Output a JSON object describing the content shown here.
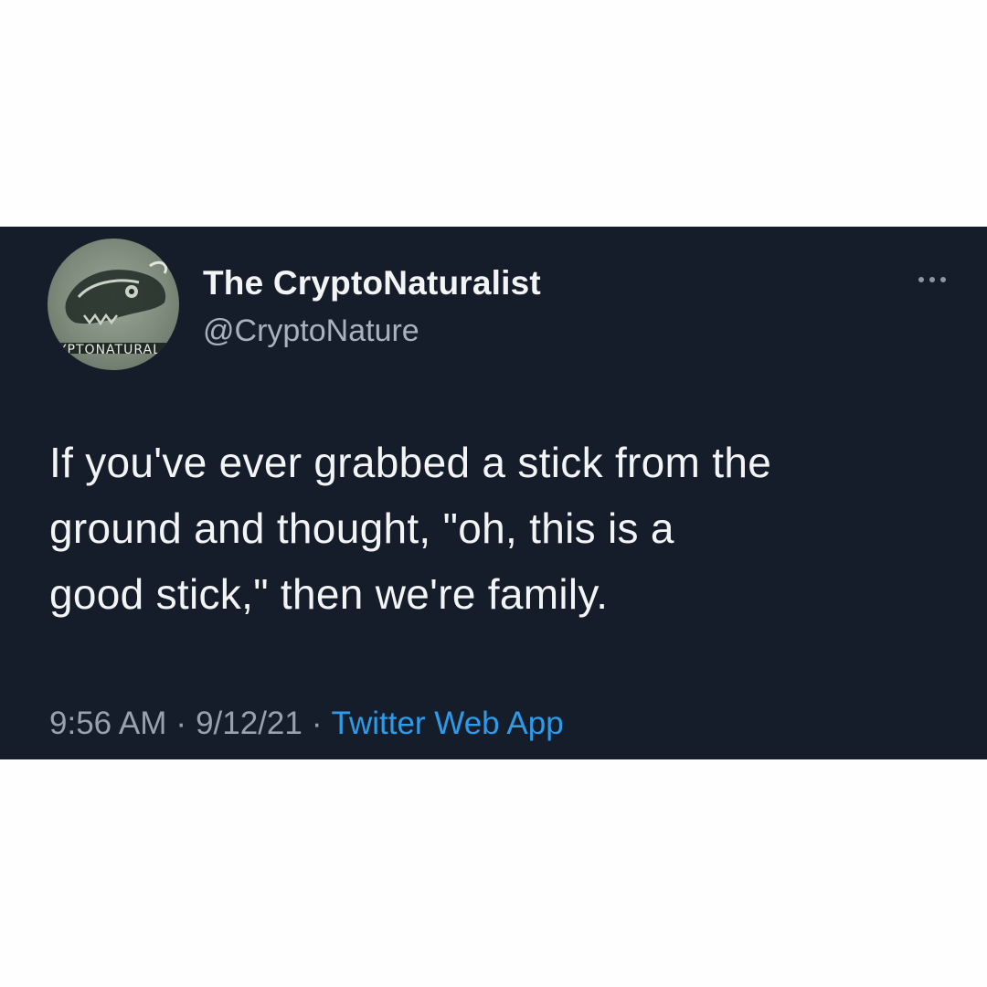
{
  "tweet": {
    "author": {
      "display_name": "The CryptoNaturalist",
      "handle": "@CryptoNature",
      "avatar_icon": "skull-logo-icon"
    },
    "more_icon": "more-dots-icon",
    "text_lines": [
      "If you've ever grabbed a stick from the",
      "ground and thought, \"oh, this is a",
      "good stick,\" then we're family."
    ],
    "time": "9:56 AM",
    "date": "9/12/21",
    "separator": "·",
    "source": "Twitter Web App"
  },
  "colors": {
    "card_background": "#161d2a",
    "page_background": "#fefefe",
    "source_link": "#2e9be8"
  }
}
